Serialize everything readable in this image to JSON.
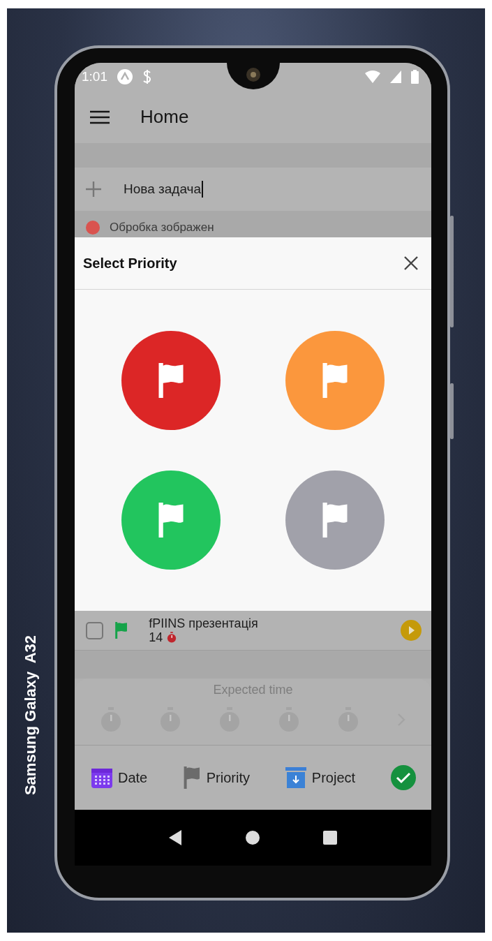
{
  "device_label": "Samsung Galaxy  A32",
  "status_bar": {
    "time": "1:01"
  },
  "app_bar": {
    "title": "Home"
  },
  "new_task": {
    "value": "Нова задача"
  },
  "background_task": {
    "title": "Обробка зображен",
    "color": "#d9534f"
  },
  "priority_modal": {
    "title": "Select Priority",
    "options": [
      {
        "color": "#dc2626"
      },
      {
        "color": "#fb973d"
      },
      {
        "color": "#22c55e"
      },
      {
        "color": "#a1a1aa"
      }
    ]
  },
  "task": {
    "title": "fPIINS презентація",
    "count": "14",
    "checked": false,
    "color": "#16a34a"
  },
  "expected_time": {
    "title": "Expected time"
  },
  "toolbar": {
    "items": [
      {
        "kind": "date",
        "label": "Date"
      },
      {
        "kind": "priority",
        "label": "Priority"
      },
      {
        "kind": "project",
        "label": "Project"
      }
    ]
  }
}
